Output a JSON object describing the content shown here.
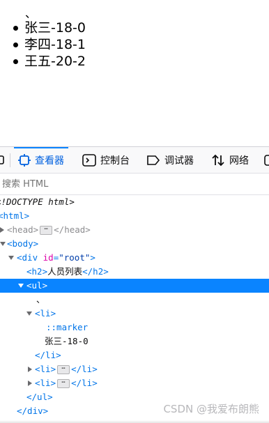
{
  "page": {
    "stray_mark": "、",
    "items": [
      "张三-18-0",
      "李四-18-1",
      "王五-20-2"
    ]
  },
  "devtools": {
    "tabs": {
      "inspector": "查看器",
      "console": "控制台",
      "debugger": "调试器",
      "network": "网络"
    },
    "search_placeholder": "搜索 HTML",
    "tree": {
      "doctype": "<!DOCTYPE html>",
      "html_open": "<html>",
      "head_open": "<head>",
      "head_close": "</head>",
      "body_open": "<body>",
      "div_open": "<div",
      "div_attr_name": "id",
      "div_attr_eq": "=",
      "div_attr_value": "\"root\"",
      "div_gt": ">",
      "h2_open": "<h2>",
      "h2_text": "人员列表",
      "h2_close": "</h2>",
      "ul_open": "<ul>",
      "text_node": "、",
      "li_open": "<li>",
      "marker": "::marker",
      "li_text": "张三-18-0",
      "li_close": "</li>",
      "ul_close": "</ul>",
      "div_close": "</div>",
      "ellipsis": "⋯"
    }
  },
  "watermark": "CSDN @我爱布朗熊"
}
